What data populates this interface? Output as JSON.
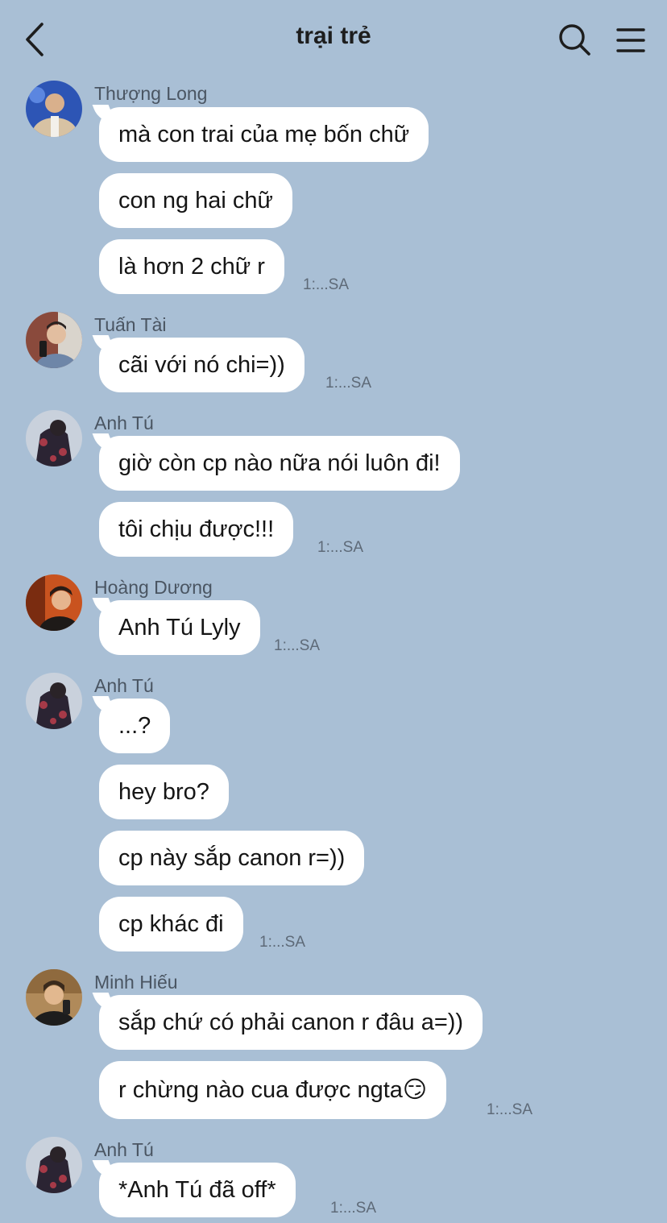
{
  "header": {
    "title": "trại trẻ",
    "back_icon": "chevron-left-icon",
    "search_icon": "search-icon",
    "menu_icon": "hamburger-menu-icon"
  },
  "messages": [
    {
      "sender": "Thượng Long",
      "bubbles": [
        "mà con trai của mẹ bốn chữ",
        "con ng hai chữ",
        "là hơn 2 chữ r"
      ],
      "time": "1:...SA"
    },
    {
      "sender": "Tuấn Tài",
      "bubbles": [
        "cãi với nó chi=))"
      ],
      "time": "1:...SA"
    },
    {
      "sender": "Anh Tú",
      "bubbles": [
        "giờ còn cp nào nữa nói luôn đi!",
        "tôi chịu được!!!"
      ],
      "time": "1:...SA"
    },
    {
      "sender": "Hoàng Dương",
      "bubbles": [
        "Anh Tú Lyly"
      ],
      "time": "1:...SA"
    },
    {
      "sender": "Anh Tú",
      "bubbles": [
        "...?",
        "hey bro?",
        "cp này sắp canon r=))",
        "cp khác đi"
      ],
      "time": "1:...SA"
    },
    {
      "sender": "Minh Hiếu",
      "bubbles": [
        "sắp chứ có phải canon r đâu a=))",
        "r chừng nào cua được ngta😏"
      ],
      "time": "1:...SA"
    },
    {
      "sender": "Anh Tú",
      "bubbles": [
        "*Anh Tú đã off*"
      ],
      "time": "1:...SA"
    }
  ],
  "colors": {
    "background": "#a9bfd5",
    "bubble": "#ffffff",
    "name_text": "#4a5562",
    "time_text": "#5e6a78"
  }
}
